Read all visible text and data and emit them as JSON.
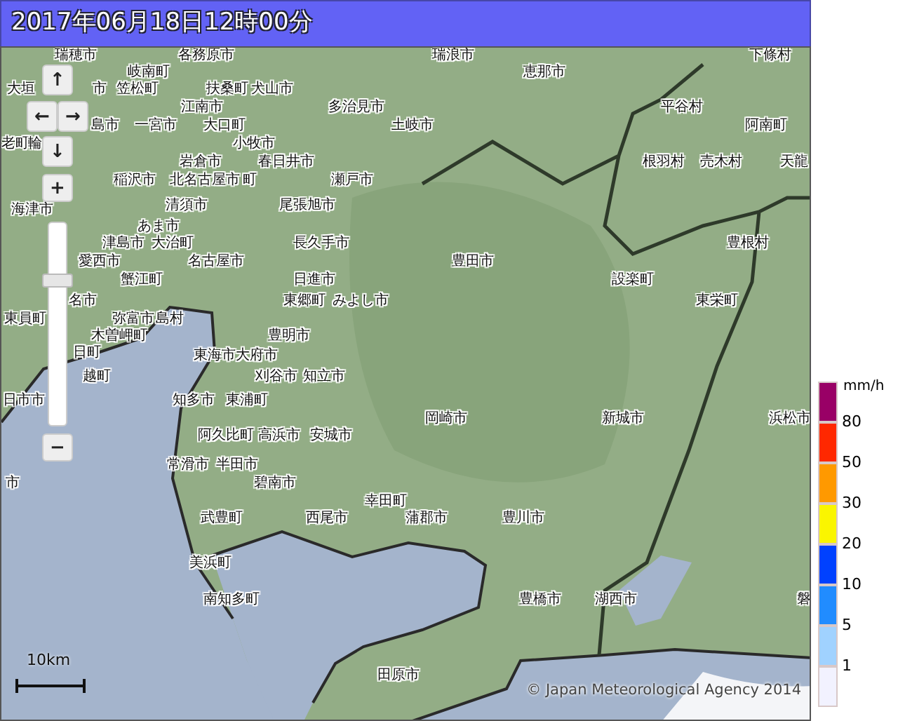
{
  "title": "2017年06月18日12時00分",
  "map": {
    "places": [
      "瑞穂市",
      "各務原市",
      "瑞浪市",
      "下條村",
      "岐南町",
      "恵那市",
      "大垣",
      "市",
      "笠松町",
      "扶桑町",
      "犬山市",
      "江南市",
      "多治見市",
      "平谷村",
      "島市",
      "一宮市",
      "大口町",
      "土岐市",
      "阿南町",
      "老町",
      "輪",
      "小牧市",
      "岩倉市",
      "春日井市",
      "根羽村",
      "売木村",
      "天龍",
      "稲沢市",
      "北名古屋市",
      "町",
      "瀬戸市",
      "海津市",
      "清須市",
      "尾張旭市",
      "あま市",
      "津島市",
      "大治町",
      "長久手市",
      "豊根村",
      "愛西市",
      "名古屋市",
      "豊田市",
      "蟹江町",
      "日進市",
      "設楽町",
      "名市",
      "東郷町",
      "みよし市",
      "東栄町",
      "東員町",
      "弥富市",
      "島村",
      "木曽岬町",
      "豊明市",
      "日町",
      "東海市",
      "大府市",
      "越町",
      "刈谷市",
      "知立市",
      "日市市",
      "知多市",
      "東浦町",
      "岡崎市",
      "新城市",
      "浜松市",
      "阿久比町",
      "高浜市",
      "安城市",
      "常滑市",
      "半田市",
      "市",
      "碧南市",
      "幸田町",
      "武豊町",
      "西尾市",
      "蒲郡市",
      "豊川市",
      "美浜町",
      "南知多町",
      "豊橋市",
      "湖西市",
      "磐",
      "田原市"
    ],
    "controls": {
      "pan": [
        "↑",
        "←",
        "→",
        "↓"
      ],
      "zoom_in": "+",
      "zoom_out": "−",
      "zoom_slider": {
        "level": 0.72
      }
    },
    "scale": "10km",
    "attribution": "© Japan Meteorological Agency 2014"
  },
  "legend": {
    "unit": "mm/h",
    "swatches": [
      {
        "color": "#990066"
      },
      {
        "color": "#ff2800"
      },
      {
        "color": "#ff9900"
      },
      {
        "color": "#faf500"
      },
      {
        "color": "#0041ff"
      },
      {
        "color": "#218cff"
      },
      {
        "color": "#a0d2ff"
      },
      {
        "color": "#f2f2ff"
      }
    ],
    "values": [
      "80",
      "50",
      "30",
      "20",
      "10",
      "5",
      "1"
    ]
  }
}
